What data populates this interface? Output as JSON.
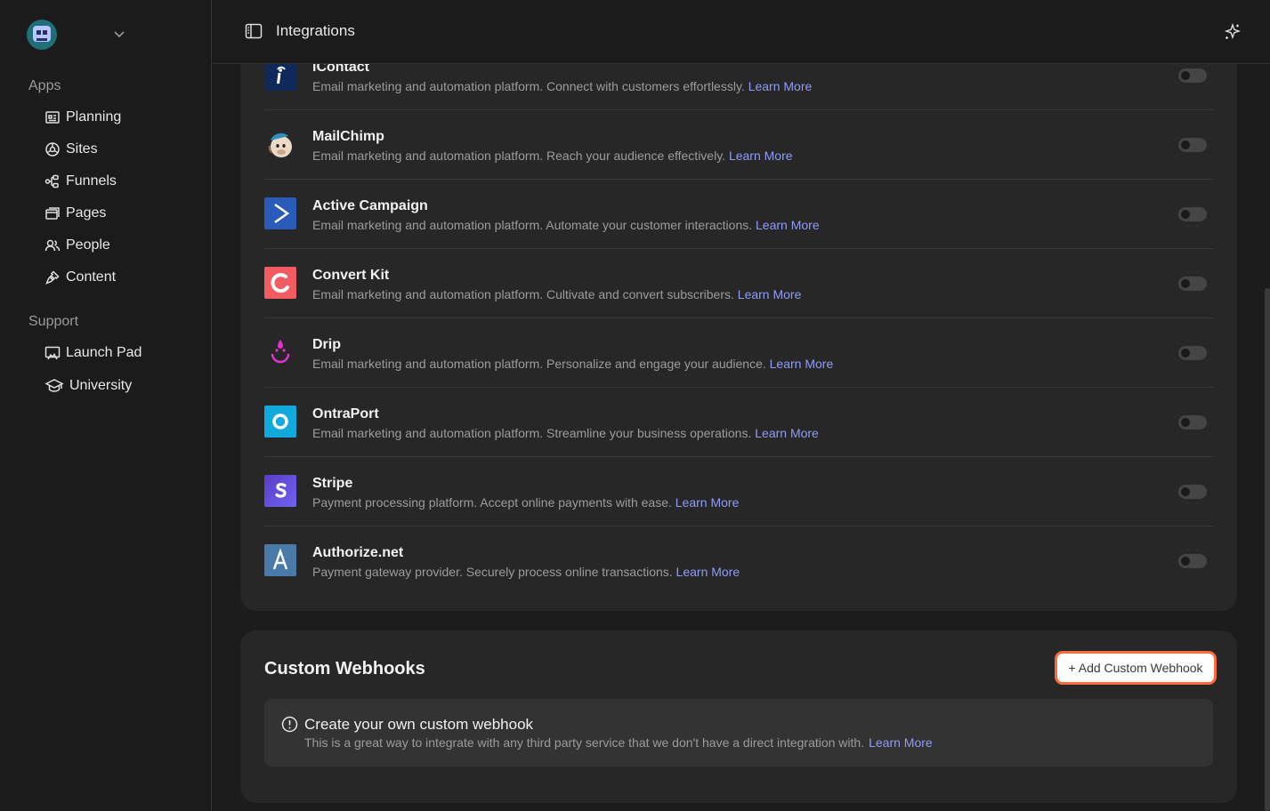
{
  "sidebar": {
    "sections": {
      "apps": "Apps",
      "support": "Support"
    },
    "apps": [
      {
        "label": "Planning"
      },
      {
        "label": "Sites"
      },
      {
        "label": "Funnels"
      },
      {
        "label": "Pages"
      },
      {
        "label": "People"
      },
      {
        "label": "Content"
      }
    ],
    "support": [
      {
        "label": "Launch Pad"
      },
      {
        "label": "University"
      }
    ]
  },
  "header": {
    "title": "Integrations"
  },
  "integrations": [
    {
      "name": "iContact",
      "description": "Email marketing and automation platform. Connect with customers effortlessly.",
      "link": "Learn More",
      "enabled": false
    },
    {
      "name": "MailChimp",
      "description": "Email marketing and automation platform. Reach your audience effectively.",
      "link": "Learn More",
      "enabled": false
    },
    {
      "name": "Active Campaign",
      "description": "Email marketing and automation platform. Automate your customer interactions.",
      "link": "Learn More",
      "enabled": false
    },
    {
      "name": "Convert Kit",
      "description": "Email marketing and automation platform. Cultivate and convert subscribers.",
      "link": "Learn More",
      "enabled": false
    },
    {
      "name": "Drip",
      "description": "Email marketing and automation platform. Personalize and engage your audience.",
      "link": "Learn More",
      "enabled": false
    },
    {
      "name": "OntraPort",
      "description": "Email marketing and automation platform. Streamline your business operations.",
      "link": "Learn More",
      "enabled": false
    },
    {
      "name": "Stripe",
      "description": "Payment processing platform. Accept online payments with ease.",
      "link": "Learn More",
      "enabled": false
    },
    {
      "name": "Authorize.net",
      "description": "Payment gateway provider. Securely process online transactions.",
      "link": "Learn More",
      "enabled": false
    }
  ],
  "webhooks": {
    "title": "Custom Webhooks",
    "add_button": "+ Add Custom Webhook",
    "info_title": "Create your own custom webhook",
    "info_text": "This is a great way to integrate with any third party service that we don't have a direct integration with.",
    "info_link": "Learn More"
  },
  "colors": {
    "accent_link": "#8f9cf7",
    "focus_ring": "#ff6a3d",
    "background": "#1c1c1c",
    "card": "#272727"
  },
  "icons": {
    "sidebar_toggle": "sidebar-toggle-icon",
    "ai": "sparkle-icon",
    "info": "info-circle-icon"
  }
}
